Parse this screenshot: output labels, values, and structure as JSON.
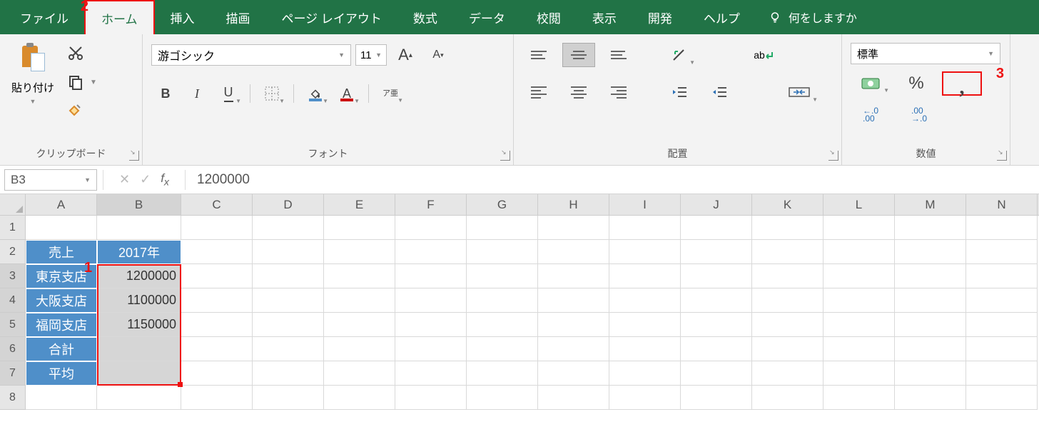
{
  "tabs": {
    "file": "ファイル",
    "home": "ホーム",
    "insert": "挿入",
    "draw": "描画",
    "pagelayout": "ページ レイアウト",
    "formulas": "数式",
    "data": "データ",
    "review": "校閲",
    "view": "表示",
    "developer": "開発",
    "help": "ヘルプ",
    "tellme": "何をしますか"
  },
  "annotations": {
    "a1": "1",
    "a2": "2",
    "a3": "3"
  },
  "clipboard": {
    "paste": "貼り付け",
    "group": "クリップボード"
  },
  "font": {
    "name": "游ゴシック",
    "size": "11",
    "group": "フォント",
    "bold": "B",
    "italic": "I",
    "underline": "U",
    "ruby": "ア亜"
  },
  "alignment": {
    "group": "配置",
    "wrap": "ab"
  },
  "number": {
    "format": "標準",
    "group": "数値",
    "percent": "%",
    "comma": ",",
    "incdec1": "←.0",
    "incdec1b": ".00",
    "incdec2": ".00",
    "incdec2b": "→.0"
  },
  "formula_bar": {
    "namebox": "B3",
    "value": "1200000"
  },
  "columns": [
    "A",
    "B",
    "C",
    "D",
    "E",
    "F",
    "G",
    "H",
    "I",
    "J",
    "K",
    "L",
    "M",
    "N"
  ],
  "rowcount": 8,
  "sheet": {
    "A2": "売上",
    "B2": "2017年",
    "A3": "東京支店",
    "B3": "1200000",
    "A4": "大阪支店",
    "B4": "1100000",
    "A5": "福岡支店",
    "B5": "1150000",
    "A6": "合計",
    "A7": "平均"
  }
}
